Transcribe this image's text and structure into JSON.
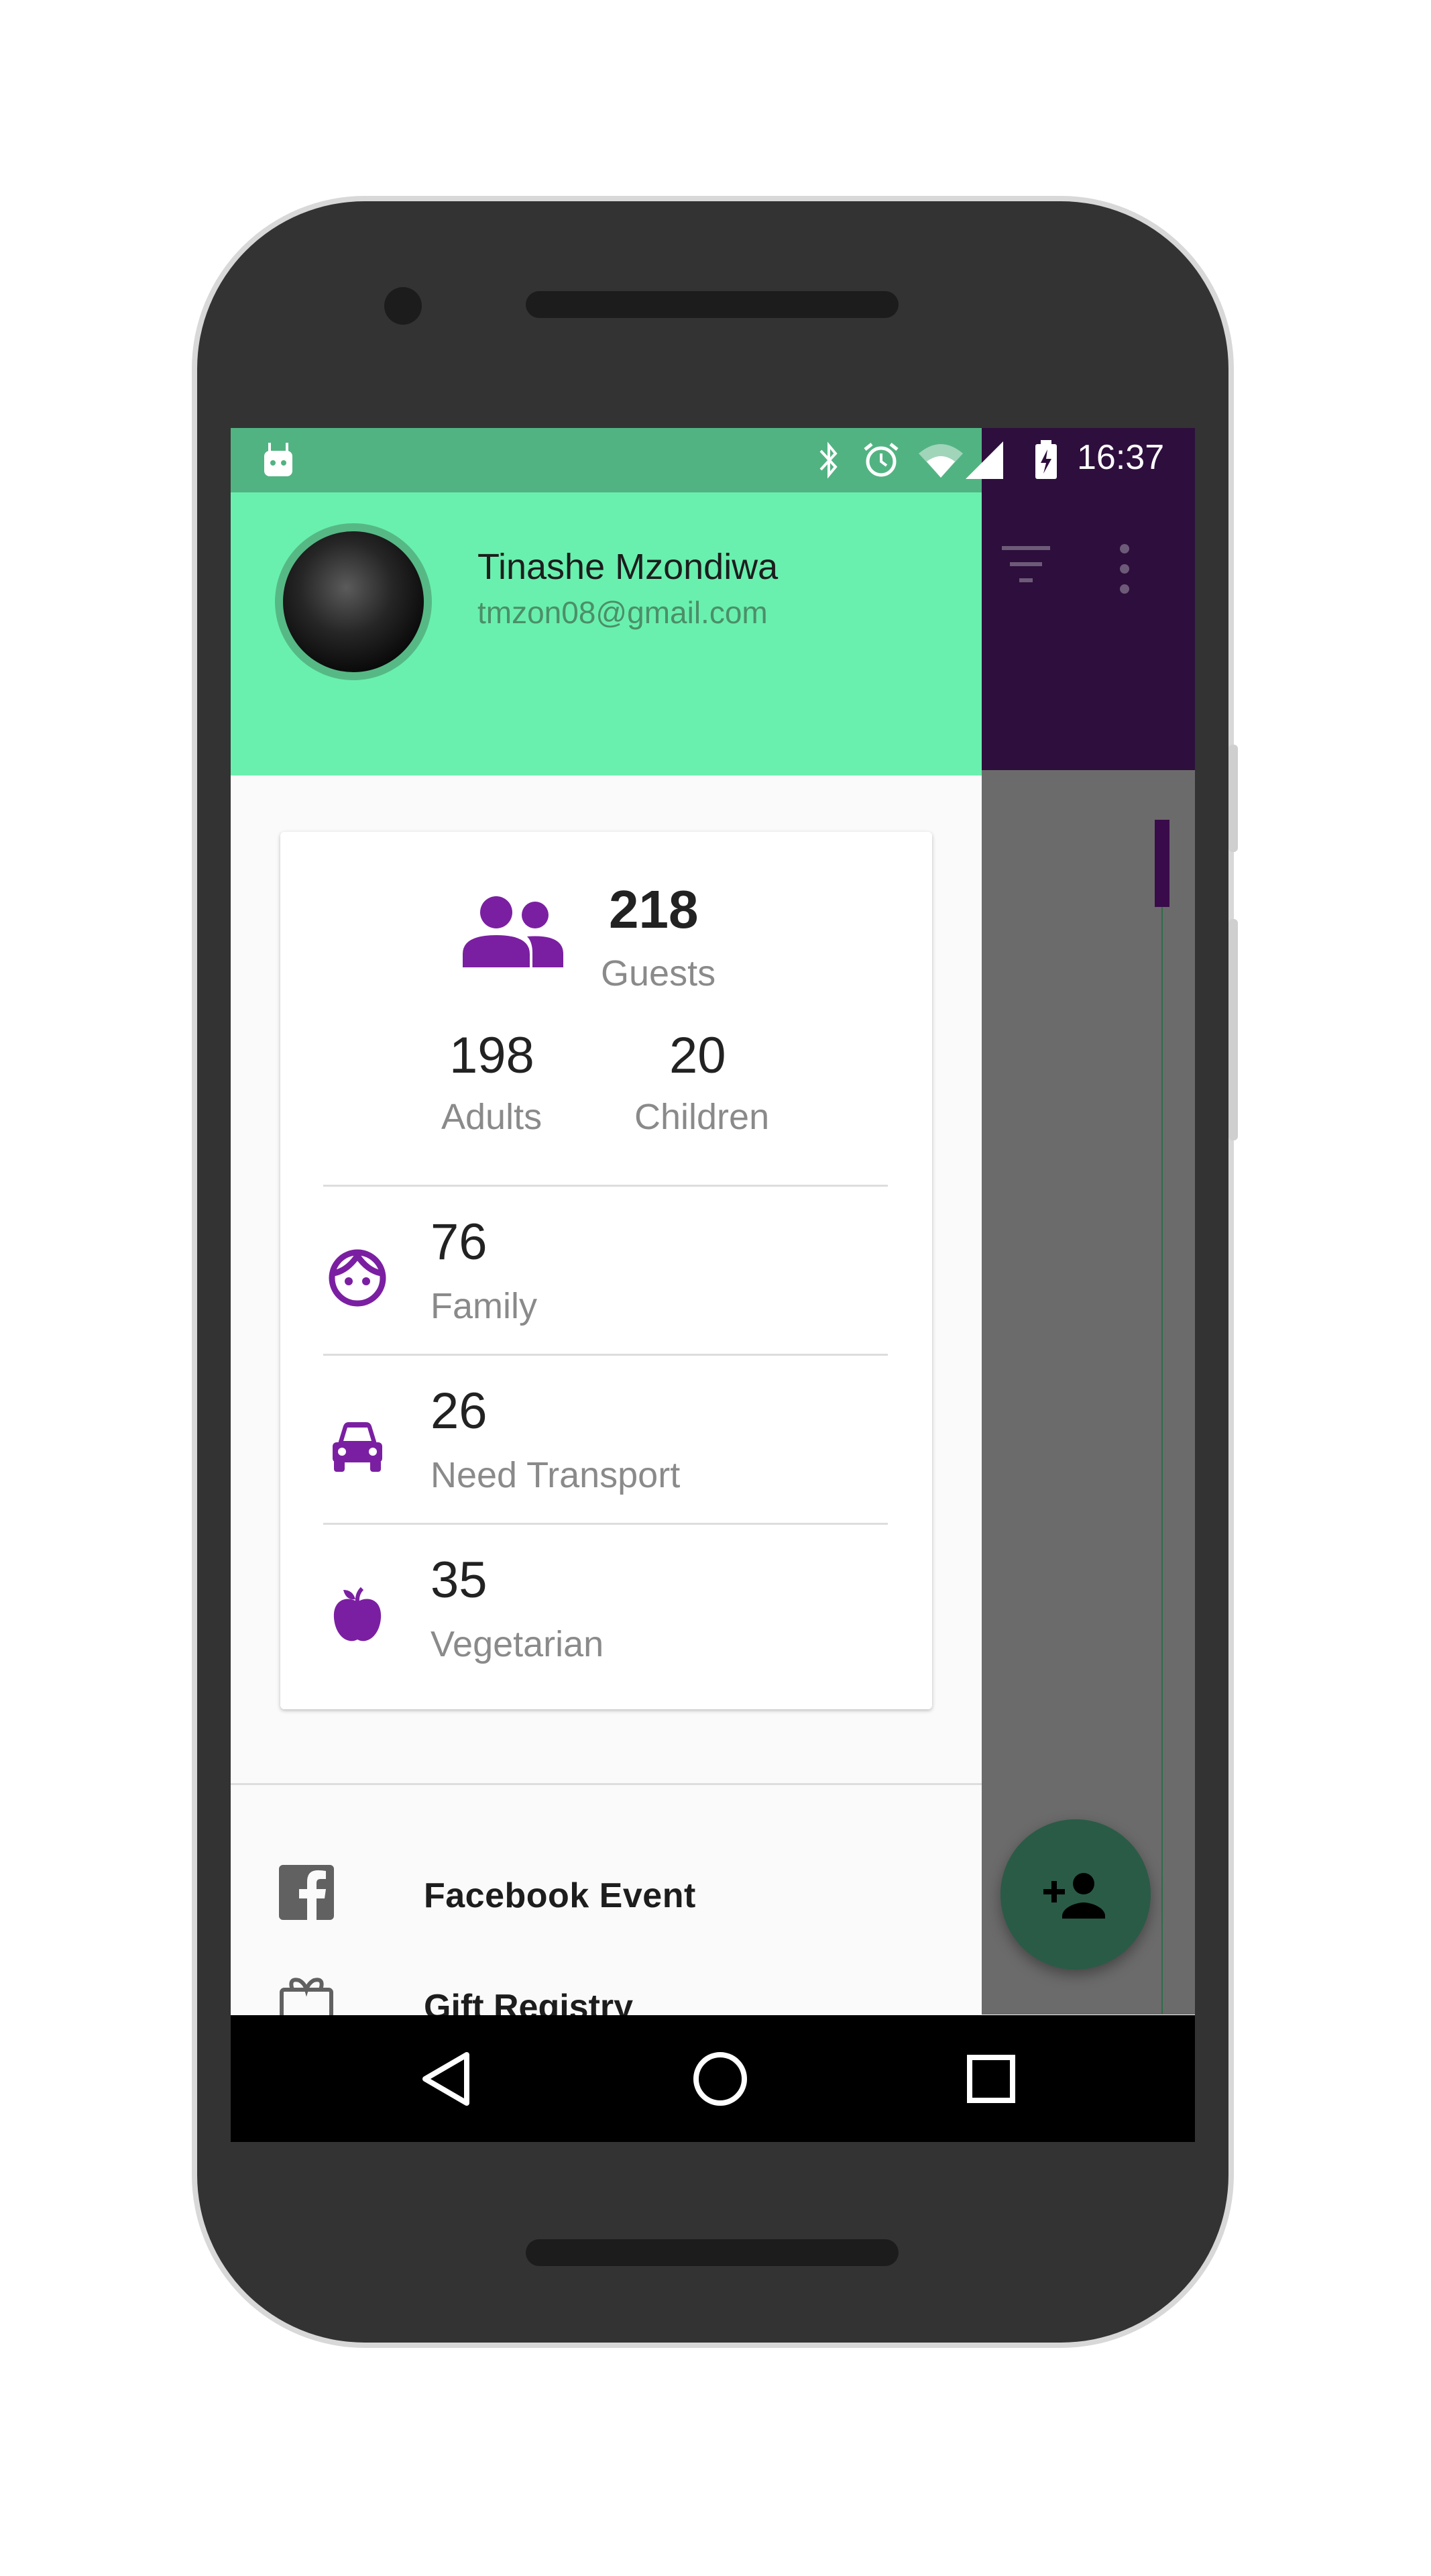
{
  "status_bar": {
    "time": "16:37",
    "icons": [
      "android-icon",
      "bluetooth-icon",
      "alarm-icon",
      "wifi-icon",
      "signal-icon",
      "battery-charging-icon"
    ]
  },
  "app_bar": {
    "icons": [
      "filter-icon",
      "more-vert-icon"
    ],
    "color": "#2e0e3d"
  },
  "drawer": {
    "header": {
      "name": "Tinashe Mzondiwa",
      "email": "tmzon08@gmail.com",
      "color": "#69f0ae"
    },
    "stats": {
      "guests": {
        "value": "218",
        "label": "Guests"
      },
      "adults": {
        "value": "198",
        "label": "Adults"
      },
      "children": {
        "value": "20",
        "label": "Children"
      },
      "rows": [
        {
          "icon": "face-icon",
          "value": "76",
          "label": "Family"
        },
        {
          "icon": "car-icon",
          "value": "26",
          "label": "Need Transport"
        },
        {
          "icon": "apple-icon",
          "value": "35",
          "label": "Vegetarian"
        }
      ],
      "icon_color": "#7b1fa2"
    },
    "menu": [
      {
        "icon": "facebook-icon",
        "label": "Facebook Event"
      },
      {
        "icon": "gift-icon",
        "label": "Gift Registry"
      }
    ]
  },
  "fab": {
    "icon": "add-person-icon",
    "color": "#2a5b47"
  },
  "nav_bar": {
    "buttons": [
      "back-icon",
      "home-icon",
      "recents-icon"
    ]
  }
}
